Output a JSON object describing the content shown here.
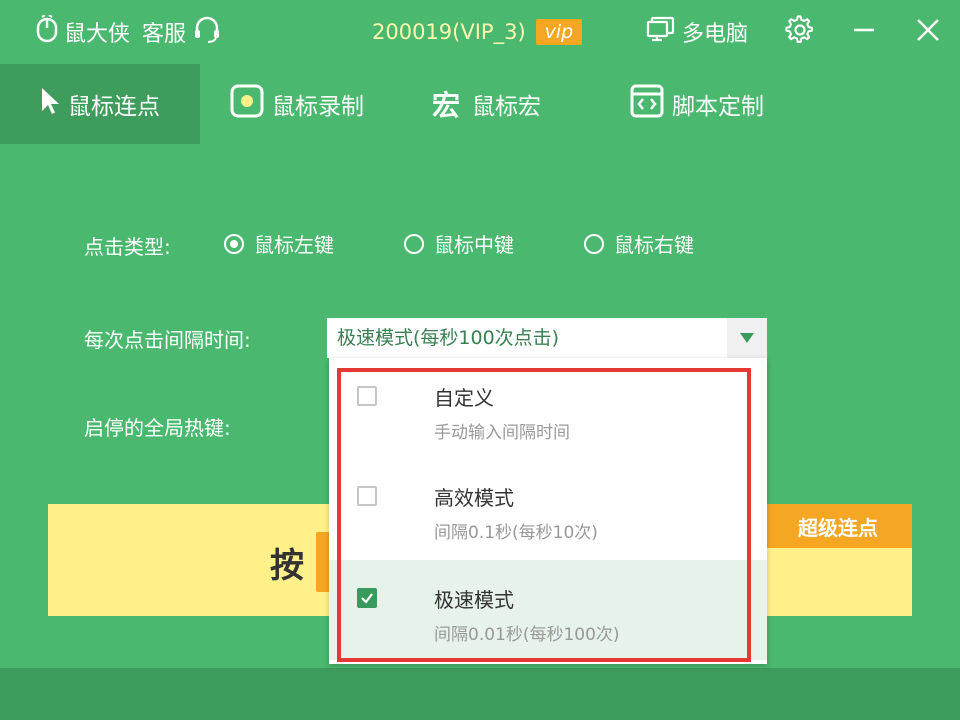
{
  "titlebar": {
    "app_name": "鼠大侠",
    "service_label": "客服",
    "user_id": "200019(VIP_3)",
    "vip_badge": "vip",
    "multi_pc_label": "多电脑"
  },
  "tabs": [
    {
      "label": "鼠标连点",
      "icon": "cursor-icon",
      "active": true
    },
    {
      "label": "鼠标录制",
      "icon": "record-icon",
      "active": false
    },
    {
      "label": "鼠标宏",
      "icon_text": "宏",
      "active": false
    },
    {
      "label": "脚本定制",
      "icon": "script-icon",
      "active": false
    }
  ],
  "form": {
    "click_type_label": "点击类型:",
    "radios": [
      {
        "label": "鼠标左键",
        "checked": true
      },
      {
        "label": "鼠标中键",
        "checked": false
      },
      {
        "label": "鼠标右键",
        "checked": false
      }
    ],
    "interval_label": "每次点击间隔时间:",
    "interval_value": "极速模式(每秒100次点击)",
    "hotkey_label": "启停的全局热键:"
  },
  "start_panel": {
    "press_text": "按",
    "super_button": "超级连点"
  },
  "dropdown": {
    "options": [
      {
        "title": "自定义",
        "desc": "手动输入间隔时间",
        "checked": false
      },
      {
        "title": "高效模式",
        "desc": "间隔0.1秒(每秒10次)",
        "checked": false
      },
      {
        "title": "极速模式",
        "desc": "间隔0.01秒(每秒100次)",
        "checked": true
      }
    ]
  },
  "colors": {
    "background": "#4ab86e",
    "active_tab": "#3e9c5c",
    "accent_orange": "#f5a623",
    "panel_yellow": "#fff08a",
    "highlight_red": "#e53935"
  }
}
